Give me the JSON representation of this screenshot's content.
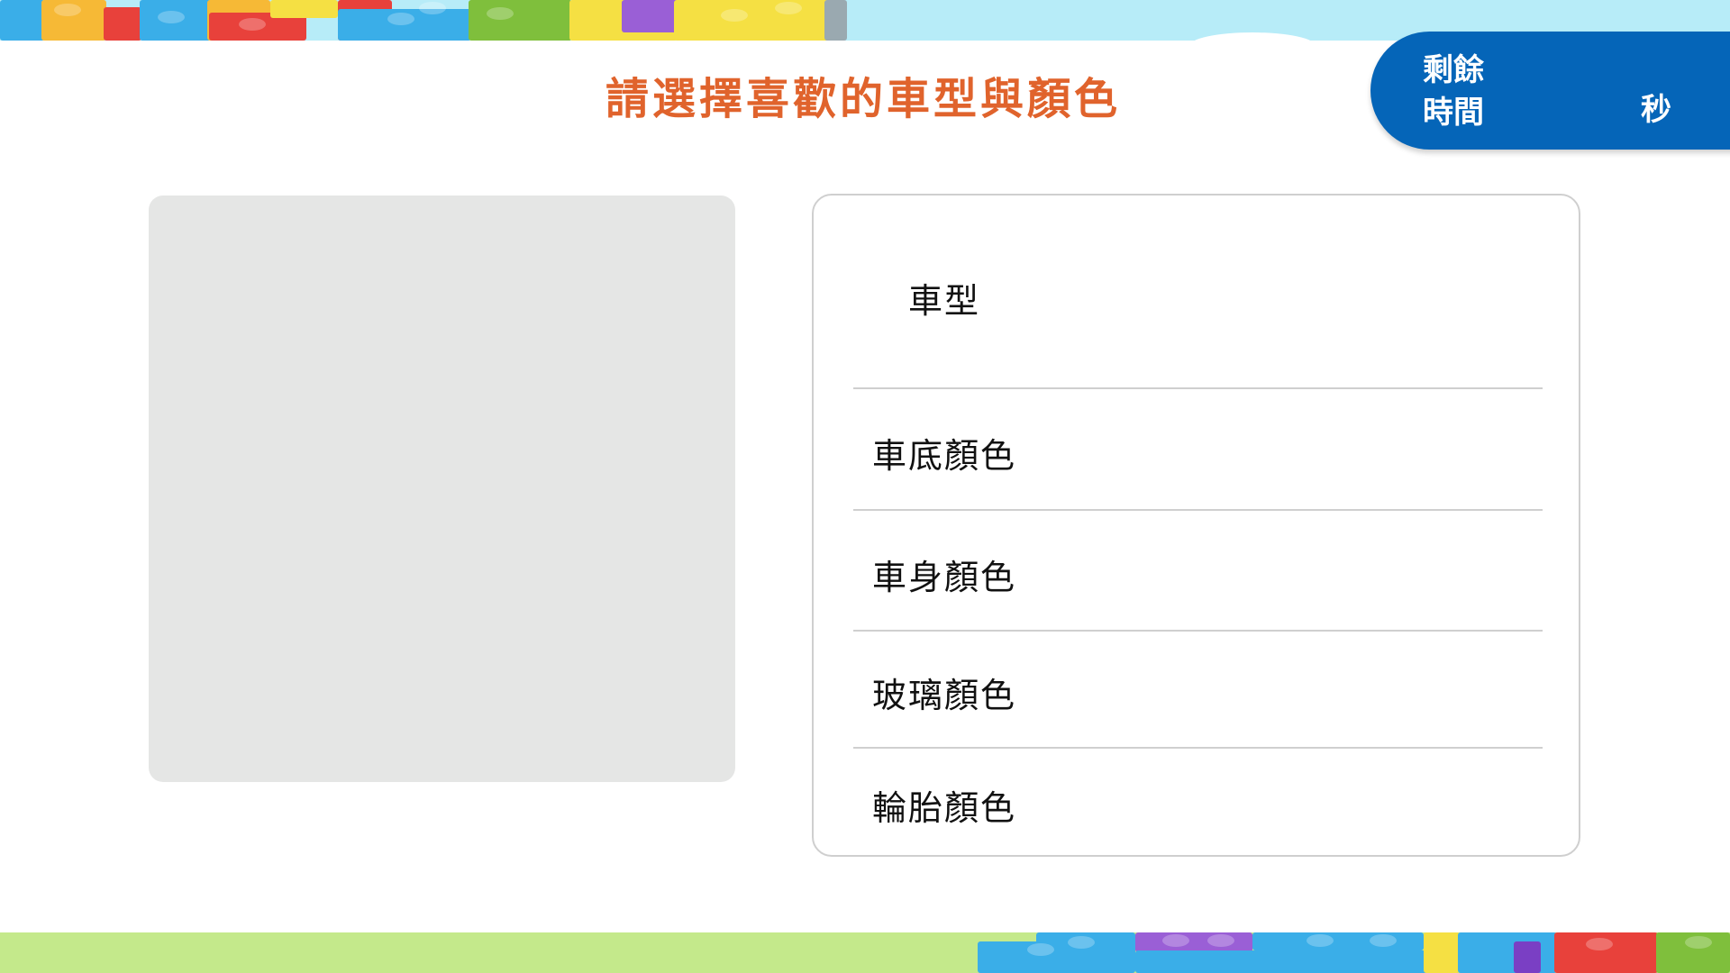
{
  "header": {
    "title": "請選擇喜歡的車型與顏色",
    "title_color": "#e0632c"
  },
  "timer": {
    "label_line1": "剩餘",
    "label_line2": "時間",
    "value": "",
    "unit": "秒",
    "background": "#0565b8"
  },
  "preview": {
    "background": "#e5e6e5"
  },
  "options": {
    "items": [
      {
        "label": "車型"
      },
      {
        "label": "車底顏色"
      },
      {
        "label": "車身顏色"
      },
      {
        "label": "玻璃顏色"
      },
      {
        "label": "輪胎顏色"
      }
    ]
  },
  "decor": {
    "sky_color": "#b7ecf8",
    "grass_color": "#c4e98b",
    "brick_colors": [
      "#f6b936",
      "#e8413b",
      "#3aaee8",
      "#f5e043",
      "#7fbf3c",
      "#9a5fd6"
    ]
  }
}
